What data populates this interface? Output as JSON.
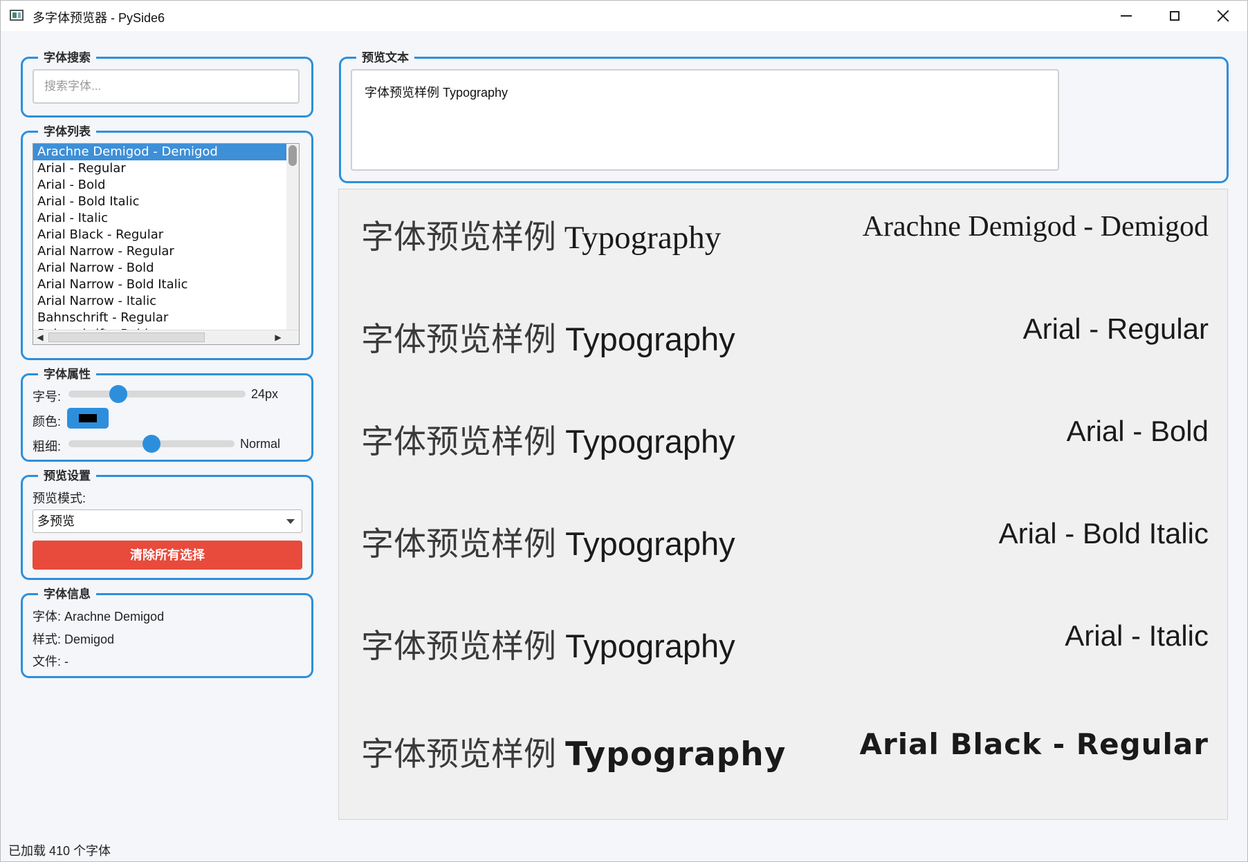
{
  "window": {
    "title": "多字体预览器 - PySide6"
  },
  "search": {
    "group_title": "字体搜索",
    "placeholder": "搜索字体..."
  },
  "font_list": {
    "group_title": "字体列表",
    "items": [
      "Arachne Demigod - Demigod",
      "Arial - Regular",
      "Arial - Bold",
      "Arial - Bold Italic",
      "Arial - Italic",
      "Arial Black - Regular",
      "Arial Narrow - Regular",
      "Arial Narrow - Bold",
      "Arial Narrow - Bold Italic",
      "Arial Narrow - Italic",
      "Bahnschrift - Regular",
      "Bahnschrift - Bold"
    ],
    "selected_index": 0
  },
  "font_props": {
    "group_title": "字体属性",
    "size_label": "字号:",
    "size_value": "24px",
    "size_fraction": 0.28,
    "color_label": "颜色:",
    "color_value": "#000000",
    "weight_label": "粗细:",
    "weight_value": "Normal",
    "weight_fraction": 0.5
  },
  "preview_settings": {
    "group_title": "预览设置",
    "mode_label": "预览模式:",
    "mode_value": "多预览",
    "clear_label": "清除所有选择"
  },
  "font_info": {
    "group_title": "字体信息",
    "font_line": "字体: Arachne Demigod",
    "style_line": "样式: Demigod",
    "file_line": "文件: -"
  },
  "preview_text": {
    "group_title": "预览文本",
    "value": "字体预览样例 Typography"
  },
  "previews": [
    {
      "cjk": "字体预览样例",
      "latin": "Typography",
      "name": "Arachne Demigod - Demigod"
    },
    {
      "cjk": "字体预览样例",
      "latin": "Typography",
      "name": "Arial - Regular"
    },
    {
      "cjk": "字体预览样例",
      "latin": "Typography",
      "name": "Arial - Bold"
    },
    {
      "cjk": "字体预览样例",
      "latin": "Typography",
      "name": "Arial - Bold Italic"
    },
    {
      "cjk": "字体预览样例",
      "latin": "Typography",
      "name": "Arial - Italic"
    },
    {
      "cjk": "字体预览样例",
      "latin": "Typography",
      "name": "Arial Black - Regular"
    }
  ],
  "status": {
    "text": "已加载 410 个字体"
  },
  "colors": {
    "accent": "#2d8fdc",
    "danger": "#e84a3b",
    "selection": "#3d8fd8"
  }
}
